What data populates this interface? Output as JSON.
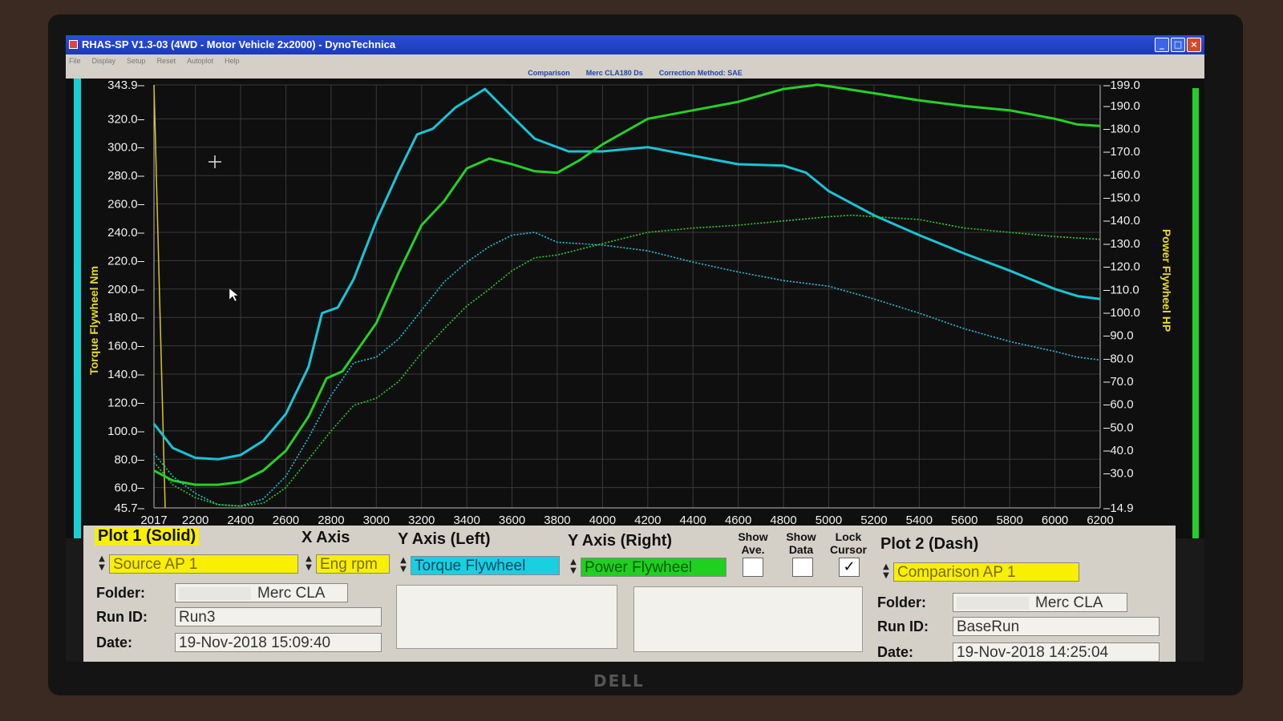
{
  "window": {
    "title": "RHAS-SP V1.3-03  (4WD - Motor Vehicle 2x2000) - DynoTechnica",
    "menu": [
      "File",
      "Display",
      "Setup",
      "Reset",
      "Autoplot",
      "Help"
    ],
    "comparison_label": "Comparison",
    "comparison_value": "Merc CLA180 Ds",
    "correction_label": "Correction Method: SAE"
  },
  "chart_data": {
    "type": "line",
    "x_ticks": [
      2017,
      2200,
      2400,
      2600,
      2800,
      3000,
      3200,
      3400,
      3600,
      3800,
      4000,
      4200,
      4400,
      4600,
      4800,
      5000,
      5200,
      5400,
      5600,
      5800,
      6000,
      6200
    ],
    "xlim": [
      2017,
      6200
    ],
    "ylabel_left": "Torque Flywheel Nm",
    "ylabel_right": "Power Flywheel HP",
    "ylim_left": [
      45.7,
      343.9
    ],
    "ylim_right": [
      14.9,
      199.0
    ],
    "y_ticks_left": [
      "343.9",
      "320.0",
      "300.0",
      "280.0",
      "260.0",
      "240.0",
      "220.0",
      "200.0",
      "180.0",
      "160.0",
      "140.0",
      "120.0",
      "100.0",
      "80.0",
      "60.0",
      "45.7"
    ],
    "y_ticks_right": [
      "199.0",
      "190.0",
      "180.0",
      "170.0",
      "160.0",
      "150.0",
      "140.0",
      "130.0",
      "120.0",
      "110.0",
      "100.0",
      "90.0",
      "80.0",
      "70.0",
      "60.0",
      "50.0",
      "40.0",
      "30.0",
      "14.9"
    ],
    "grid": true,
    "series": [
      {
        "axis": "left",
        "color": "#19c4d6",
        "dash": false,
        "points": [
          [
            2017,
            105
          ],
          [
            2100,
            88
          ],
          [
            2200,
            81
          ],
          [
            2300,
            80
          ],
          [
            2400,
            83
          ],
          [
            2500,
            93
          ],
          [
            2600,
            112
          ],
          [
            2700,
            145
          ],
          [
            2760,
            183
          ],
          [
            2830,
            187
          ],
          [
            2900,
            207
          ],
          [
            3000,
            248
          ],
          [
            3100,
            283
          ],
          [
            3180,
            309
          ],
          [
            3250,
            313
          ],
          [
            3350,
            328
          ],
          [
            3480,
            341
          ],
          [
            3580,
            325
          ],
          [
            3700,
            306
          ],
          [
            3850,
            297
          ],
          [
            4000,
            297
          ],
          [
            4200,
            300
          ],
          [
            4400,
            294
          ],
          [
            4600,
            288
          ],
          [
            4800,
            287
          ],
          [
            4900,
            282
          ],
          [
            5000,
            269
          ],
          [
            5200,
            252
          ],
          [
            5400,
            238
          ],
          [
            5600,
            225
          ],
          [
            5800,
            213
          ],
          [
            6000,
            200
          ],
          [
            6100,
            195
          ],
          [
            6200,
            193
          ]
        ]
      },
      {
        "axis": "left",
        "color": "#27cf27",
        "dash": false,
        "points": [
          [
            2017,
            72
          ],
          [
            2100,
            65
          ],
          [
            2200,
            62
          ],
          [
            2300,
            62
          ],
          [
            2400,
            64
          ],
          [
            2500,
            72
          ],
          [
            2600,
            86
          ],
          [
            2700,
            110
          ],
          [
            2780,
            137
          ],
          [
            2850,
            142
          ],
          [
            3000,
            176
          ],
          [
            3100,
            212
          ],
          [
            3200,
            245
          ],
          [
            3300,
            262
          ],
          [
            3400,
            285
          ],
          [
            3500,
            292
          ],
          [
            3600,
            288
          ],
          [
            3700,
            283
          ],
          [
            3800,
            282
          ],
          [
            3900,
            291
          ],
          [
            4000,
            302
          ],
          [
            4200,
            320
          ],
          [
            4400,
            326
          ],
          [
            4600,
            332
          ],
          [
            4800,
            341
          ],
          [
            4950,
            344
          ],
          [
            5000,
            343
          ],
          [
            5200,
            338
          ],
          [
            5400,
            333
          ],
          [
            5600,
            329
          ],
          [
            5800,
            326
          ],
          [
            6000,
            320
          ],
          [
            6100,
            316
          ],
          [
            6200,
            315
          ]
        ]
      },
      {
        "axis": "left",
        "color": "#19c4d6",
        "dash": true,
        "points": [
          [
            2017,
            84
          ],
          [
            2100,
            68
          ],
          [
            2200,
            56
          ],
          [
            2300,
            48
          ],
          [
            2400,
            47
          ],
          [
            2500,
            52
          ],
          [
            2600,
            68
          ],
          [
            2700,
            95
          ],
          [
            2800,
            125
          ],
          [
            2900,
            148
          ],
          [
            3000,
            152
          ],
          [
            3100,
            165
          ],
          [
            3200,
            185
          ],
          [
            3300,
            205
          ],
          [
            3400,
            219
          ],
          [
            3500,
            230
          ],
          [
            3600,
            238
          ],
          [
            3700,
            240
          ],
          [
            3800,
            233
          ],
          [
            3900,
            232
          ],
          [
            4000,
            231
          ],
          [
            4200,
            227
          ],
          [
            4400,
            219
          ],
          [
            4600,
            212
          ],
          [
            4800,
            206
          ],
          [
            5000,
            202
          ],
          [
            5200,
            193
          ],
          [
            5400,
            183
          ],
          [
            5600,
            172
          ],
          [
            5800,
            163
          ],
          [
            6000,
            156
          ],
          [
            6100,
            152
          ],
          [
            6200,
            150
          ]
        ]
      },
      {
        "axis": "left",
        "color": "#27cf27",
        "dash": true,
        "points": [
          [
            2017,
            78
          ],
          [
            2100,
            62
          ],
          [
            2200,
            53
          ],
          [
            2300,
            48
          ],
          [
            2400,
            47
          ],
          [
            2500,
            49
          ],
          [
            2600,
            60
          ],
          [
            2700,
            80
          ],
          [
            2800,
            100
          ],
          [
            2900,
            118
          ],
          [
            3000,
            123
          ],
          [
            3100,
            135
          ],
          [
            3200,
            155
          ],
          [
            3300,
            172
          ],
          [
            3400,
            188
          ],
          [
            3500,
            200
          ],
          [
            3600,
            213
          ],
          [
            3700,
            222
          ],
          [
            3800,
            224
          ],
          [
            3900,
            228
          ],
          [
            4000,
            232
          ],
          [
            4200,
            240
          ],
          [
            4400,
            243
          ],
          [
            4600,
            245
          ],
          [
            4800,
            248
          ],
          [
            5000,
            251
          ],
          [
            5100,
            252
          ],
          [
            5200,
            251
          ],
          [
            5400,
            249
          ],
          [
            5600,
            243
          ],
          [
            5800,
            240
          ],
          [
            6000,
            237
          ],
          [
            6100,
            236
          ],
          [
            6200,
            235
          ]
        ]
      }
    ]
  },
  "panel": {
    "plot1_title": "Plot 1 (Solid)",
    "x_axis_title": "X Axis",
    "y_left_title": "Y Axis (Left)",
    "y_right_title": "Y Axis (Right)",
    "show_ave": "Show Ave.",
    "show_data": "Show Data",
    "lock_cursor": "Lock Cursor",
    "plot2_title": "Plot 2 (Dash)",
    "plot1_source": "Source AP 1",
    "x_axis_value": "Eng rpm",
    "y_left_value": "Torque Flywheel",
    "y_right_value": "Power Flywheel",
    "plot2_source": "Comparison AP 1",
    "lock_cursor_mark": "✓",
    "folder_label": "Folder:",
    "runid_label": "Run ID:",
    "date_label": "Date:",
    "plot1_folder": "Merc CLA",
    "plot1_runid": "Run3",
    "plot1_date": "19-Nov-2018  15:09:40",
    "plot2_folder": "Merc CLA",
    "plot2_runid": "BaseRun",
    "plot2_date": "19-Nov-2018  14:25:04"
  },
  "monitor_brand": "DELL"
}
